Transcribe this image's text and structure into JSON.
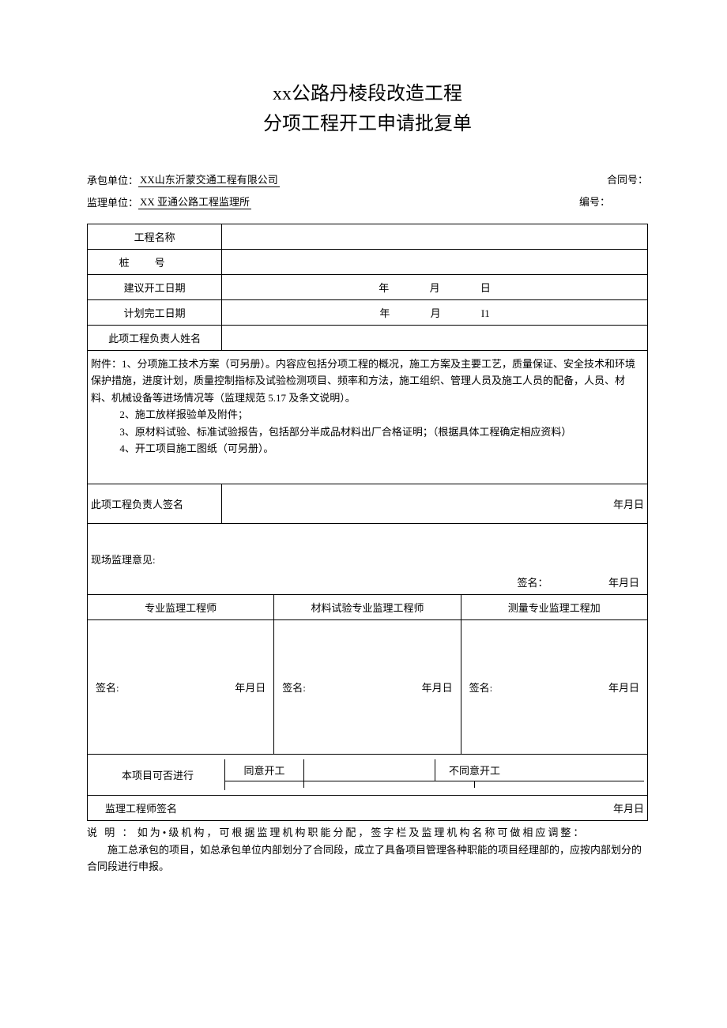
{
  "title": {
    "line1": "xx公路丹棱段改造工程",
    "line2": "分项工程开工申请批复单"
  },
  "meta": {
    "contractor_label": "承包单位：",
    "contractor_value": "XX山东沂蒙交通工程有限公司",
    "contract_no_label": "合同号：",
    "supervisor_label": "监理单位：",
    "supervisor_value": "XX 亚通公路工程监理所",
    "serial_no_label": "编号："
  },
  "rows": {
    "project_name": "工程名称",
    "pile_no": "桩号",
    "proposed_start": "建议开工日期",
    "planned_finish": "计划完工日期",
    "manager_name": "此项工程负责人姓名",
    "date_year": "年",
    "date_month": "月",
    "date_day": "日",
    "date_day2": "I1"
  },
  "attachments": {
    "p1": "附件：1、分项施工技术方案（可另册）。内容应包括分项工程的概况，施工方案及主要工艺，质量保证、安全技术和环境保护措施，进度计划，质量控制指标及试验检测项目、频率和方法，施工组织、管理人员及施工人员的配备，人员、材料、机械设备等进场情况等（监理规范 5.17 及条文说明）。",
    "p2": "2、施工放样报验单及附件；",
    "p3": "3、原材料试验、标准试验报告，包括部分半成品材料出厂合格证明；（根据具体工程确定相应资料）",
    "p4": "4、开工项目施工图纸（可另册）。"
  },
  "sign": {
    "manager_sign": "此项工程负责人签名",
    "ymd": "年月日",
    "site_opinion": "现场监理意见:",
    "sign_label": "签名：",
    "col1": "专业监理工程师",
    "col2": "材料试验专业监理工程师",
    "col3": "测量专业监理工程加",
    "sig_short": "签名:"
  },
  "approval": {
    "can_proceed": "本项目可否进行",
    "agree": "同意开工",
    "disagree": "不同意开工",
    "supervisor_sign": "监理工程师签名"
  },
  "explain": {
    "label": "说 明 ：",
    "line1": "如为•级机构，可根据监理机构职能分配，签字栏及监理机构名称可做相应调整：",
    "line2": "施工总承包的项目，如总承包单位内部划分了合同段，成立了具备项目管理各种职能的项目经理部的，应按内部划分的合同段进行申报。"
  }
}
